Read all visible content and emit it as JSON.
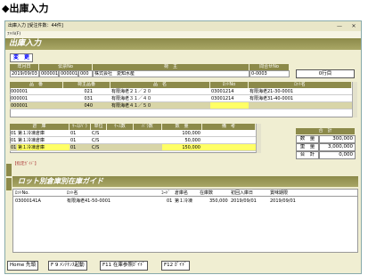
{
  "page_heading": "◆出庫入力",
  "window": {
    "title": "出庫入力 [受注件数：44件]",
    "menu": "ﾌｧｲﾙ(F)",
    "minimize": "—",
    "close": "✕"
  },
  "app_title": "出庫入力",
  "change_button": "変　更",
  "header_labels": {
    "date": "年月日",
    "company_no": "伝票No",
    "shipper": "荷　主",
    "ask_no": "問合せNo"
  },
  "header_values": {
    "date": "2019/09/03",
    "company_no_1": "000001",
    "company_no_2": "000001",
    "company_no_3": "000",
    "shipper": "株式会社　愛知水産",
    "ask_no": "0-0003"
  },
  "row_button": "0行目",
  "detail_headers": [
    "品　番",
    "荷主品番",
    "品　名",
    "ﾛｯﾄNo",
    "ﾛｯﾄ名"
  ],
  "detail_rows": [
    {
      "code": "000001",
      "sub": "021",
      "name": "有限海老２１／２０",
      "lot": "03001214",
      "lotname": "有限海老21-30-0001"
    },
    {
      "code": "000001",
      "sub": "031",
      "name": "有限海老３１／４０",
      "lot": "03001214",
      "lotname": "有限海老31-40-0001"
    },
    {
      "code": "000001",
      "sub": "040",
      "name": "有限海老４１／５０",
      "lot": "",
      "lotname": ""
    }
  ],
  "stock_headers": [
    "倉　庫",
    "ｹｰｽ/ﾊﾞﾗ",
    "単位",
    "ｹｰｽ数",
    "ﾊﾞﾗ数",
    "数　量",
    "備　考"
  ],
  "stock_rows": [
    {
      "wh_no": "01",
      "wh": "第１冷凍倉庫",
      "kind": "01",
      "unit": "C/S",
      "qty": "100,000"
    },
    {
      "wh_no": "01",
      "wh": "第１冷凍倉庫",
      "kind": "01",
      "unit": "C/S",
      "qty": "50,000"
    },
    {
      "wh_no": "01",
      "wh": "第１冷凍倉庫",
      "kind": "01",
      "unit": "C/S",
      "qty": "150,000"
    }
  ],
  "totals": {
    "header": "合　計",
    "qty_label": "数　量",
    "qty_value": "300,000",
    "weight_label": "重　量",
    "weight_value": "3,000,000",
    "amount_label": "合　計",
    "amount_value": "0,000"
  },
  "guide_hint": "【指定ｶﾞｲﾄﾞ】",
  "guide_title": "ロット別倉庫別在庫ガイド",
  "guide_headers": [
    "ﾛｯﾄNo.",
    "ﾛｯﾄ名",
    "ｺｰﾄﾞ",
    "倉庫名",
    "在庫数",
    "初回入庫日",
    "賞味期限"
  ],
  "guide_rows": [
    {
      "lot": "03000141A",
      "lotname": "有限海老41-50-0001",
      "code": "01",
      "wh": "第１冷凍",
      "stock": "350,000",
      "first": "2019/09/01",
      "expiry": "2019/09/01"
    }
  ],
  "fkeys": [
    {
      "key": "Home",
      "label": "先頭"
    },
    {
      "key": "F 9",
      "label": "ﾒﾝﾃﾅﾝｽ起動"
    },
    {
      "key": "F11",
      "label": "在庫参照ｶﾞｲﾄﾞ"
    },
    {
      "key": "F12",
      "label": "ｶﾞｲﾄﾞ"
    }
  ],
  "colors": {
    "header_bg": "#8c8a4a",
    "window_bg": "#f0eed2",
    "highlight": "#ffff66"
  }
}
